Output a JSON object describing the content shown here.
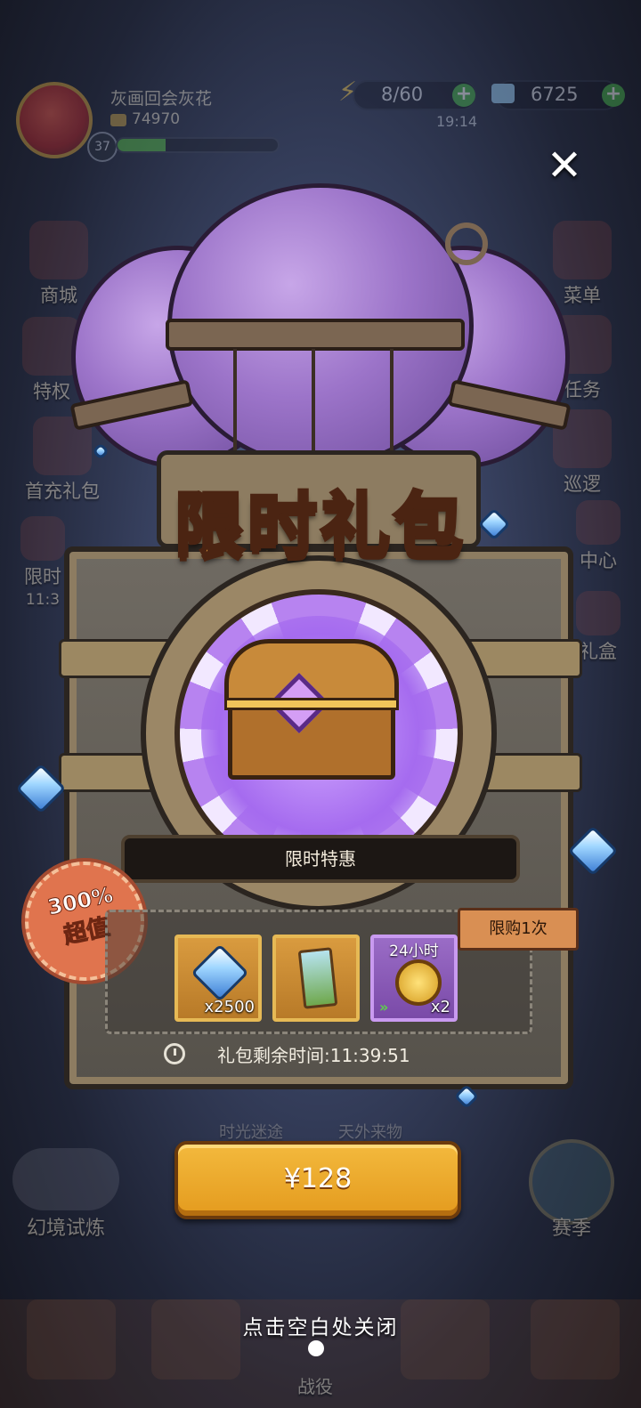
{
  "hud": {
    "player_name": "灰画回会灰花",
    "player_score": "74970",
    "level": "37",
    "xp_progress": 0.3,
    "energy": "8/60",
    "energy_timer": "19:14",
    "gems": "6725"
  },
  "side_menu_left": [
    {
      "label": "商城",
      "icon": "shop-icon"
    },
    {
      "label": "特权",
      "icon": "privilege-icon"
    },
    {
      "label": "首充礼包",
      "icon": "first-recharge-icon"
    },
    {
      "label": "限时",
      "icon": "limited-icon",
      "sub": "11:3"
    }
  ],
  "side_menu_right": [
    {
      "label": "菜单",
      "icon": "menu-icon"
    },
    {
      "label": "任务",
      "icon": "task-icon"
    },
    {
      "label": "巡逻",
      "icon": "patrol-icon"
    },
    {
      "label": "中心",
      "icon": "center-icon"
    },
    {
      "label": "礼盒",
      "icon": "giftbox-icon"
    }
  ],
  "popup": {
    "title": "限时礼包",
    "banner": "限时特惠",
    "value_badge": {
      "line1": "300%",
      "line2": "超值"
    },
    "limit_tag": "限购1次",
    "items": [
      {
        "icon": "diamond-icon",
        "qty": "x2500",
        "tag": ""
      },
      {
        "icon": "card-icon",
        "qty": "",
        "tag": ""
      },
      {
        "icon": "coin-icon",
        "qty": "x2",
        "tag": "24小时"
      }
    ],
    "remaining_label": "礼包剩余时间:11:39:51",
    "price_button": "¥128",
    "close_hint": "点击空白处关闭"
  },
  "bottom": {
    "left_label": "幻境试炼",
    "right_label": "赛季",
    "center_label": "战役",
    "faded_left": "时光迷途",
    "faded_right": "天外来物"
  },
  "colors": {
    "title": "#fbb14a",
    "button": "#f3b93d",
    "badge": "#e0744e",
    "porthole_purple": "#b783f0"
  }
}
